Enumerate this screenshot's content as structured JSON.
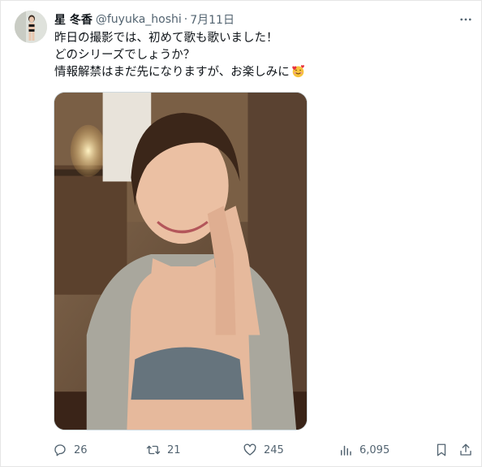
{
  "tweet": {
    "display_name": "星 冬香",
    "handle": "@fuyuka_hoshi",
    "separator": "·",
    "date": "7月11日",
    "lines": [
      "昨日の撮影では、初めて歌も歌いました！",
      "どのシリーズでしょうか？",
      "情報解禁はまだ先になりますが、お楽しみに"
    ],
    "emoji": "smiling-face-with-hearts",
    "more_icon": "more-icon"
  },
  "actions": {
    "reply_count": "26",
    "retweet_count": "21",
    "like_count": "245",
    "view_count": "6,095"
  },
  "icons": {
    "reply": "reply-icon",
    "retweet": "retweet-icon",
    "like": "like-icon",
    "views": "views-icon",
    "bookmark": "bookmark-icon",
    "share": "share-icon"
  },
  "colors": {
    "text_primary": "#0f1419",
    "text_secondary": "#536471",
    "border": "#cfd9de"
  }
}
